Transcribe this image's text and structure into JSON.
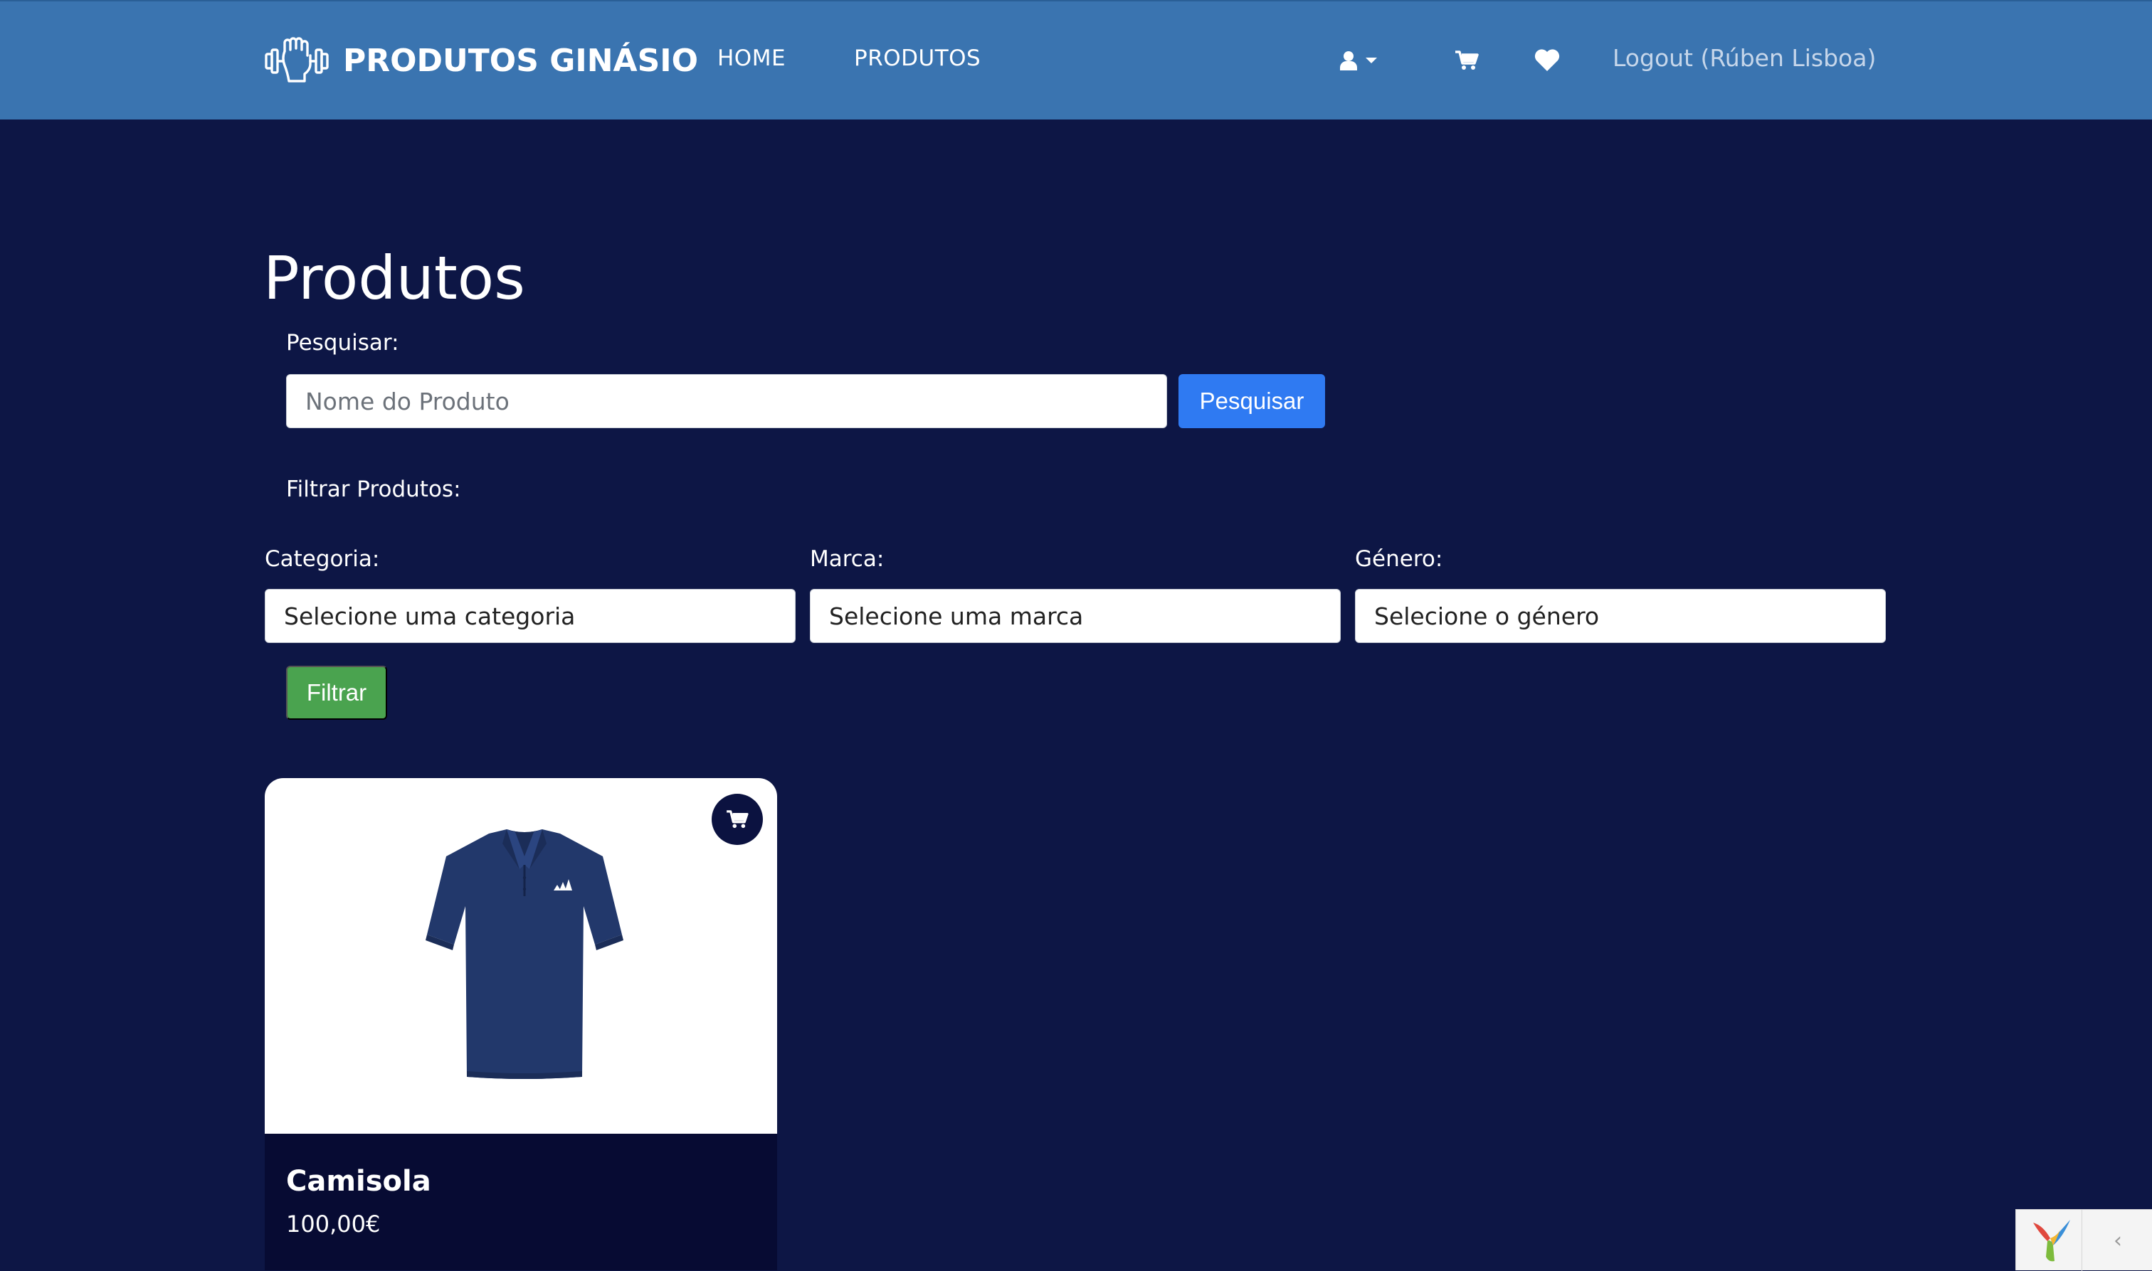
{
  "navbar": {
    "brand": "PRODUTOS GINÁSIO",
    "links": {
      "home": "HOME",
      "produtos": "PRODUTOS"
    },
    "logout": "Logout (Rúben Lisboa)",
    "icons": [
      "dumbbell-fist-logo",
      "user-icon",
      "caret-down-icon",
      "cart-icon",
      "heart-icon"
    ]
  },
  "page": {
    "title": "Produtos"
  },
  "search": {
    "label": "Pesquisar:",
    "placeholder": "Nome do Produto",
    "button": "Pesquisar"
  },
  "filters": {
    "title": "Filtrar Produtos:",
    "categoria": {
      "label": "Categoria:",
      "selected": "Selecione uma categoria"
    },
    "marca": {
      "label": "Marca:",
      "selected": "Selecione uma marca"
    },
    "genero": {
      "label": "Género:",
      "selected": "Selecione o género"
    },
    "button": "Filtrar"
  },
  "products": [
    {
      "name": "Camisola",
      "price": "100,00€",
      "image": "navy-polo-shirt"
    }
  ],
  "colors": {
    "navbar": "#3a74b0",
    "background": "#0d1645",
    "search_button": "#2f7af2",
    "filter_button": "#4aa34f",
    "card_footer": "#070b33"
  }
}
